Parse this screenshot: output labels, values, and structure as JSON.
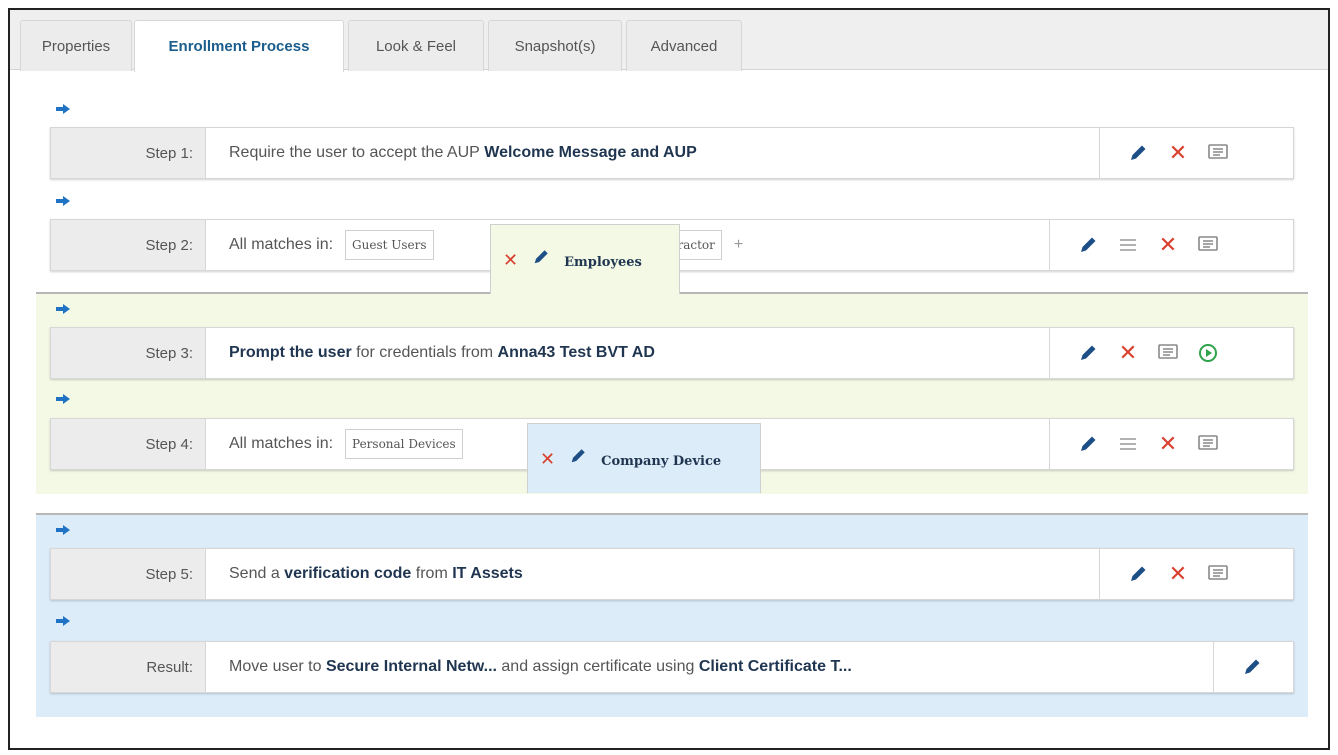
{
  "tabs": [
    {
      "label": "Properties"
    },
    {
      "label": "Enrollment Process"
    },
    {
      "label": "Look & Feel"
    },
    {
      "label": "Snapshot(s)"
    },
    {
      "label": "Advanced"
    }
  ],
  "active_tab": "Enrollment Process",
  "steps": [
    {
      "label": "Step 1:",
      "text_pre": "Require the user to accept the AUP",
      "text_bold": "Welcome Message and AUP"
    },
    {
      "label": "Step 2:",
      "prefix": "All matches in:",
      "chips": [
        "Guest Users",
        "Employees",
        "Contractor"
      ],
      "add": "+"
    },
    {
      "label": "Step 3:",
      "bold1": "Prompt the user",
      "mid": "for credentials from",
      "bold2": "Anna43 Test BVT AD"
    },
    {
      "label": "Step 4:",
      "prefix": "All matches in:",
      "chips": [
        "Personal Devices",
        "Company Device"
      ],
      "add": "+"
    },
    {
      "label": "Step 5:",
      "pre": "Send a",
      "bold1": "verification code",
      "mid": "from",
      "bold2": "IT Assets"
    }
  ],
  "result": {
    "label": "Result:",
    "pre": "Move user to",
    "bold1": "Secure Internal Netw...",
    "mid": "and assign certificate using",
    "bold2": "Client Certificate T..."
  },
  "icons": {
    "edit": "pencil-icon",
    "delete": "close-icon",
    "reorder": "menu-lines-icon",
    "comment": "comment-icon",
    "run": "play-circle-icon",
    "next": "arrow-right-icon"
  },
  "colors": {
    "accent_blue": "#1b5d8c",
    "pencil": "#1d4f86",
    "delete_red": "#d9402f",
    "run_green": "#2fa34a",
    "green_zone": "#f3f9e5",
    "blue_zone": "#dcecf8"
  }
}
